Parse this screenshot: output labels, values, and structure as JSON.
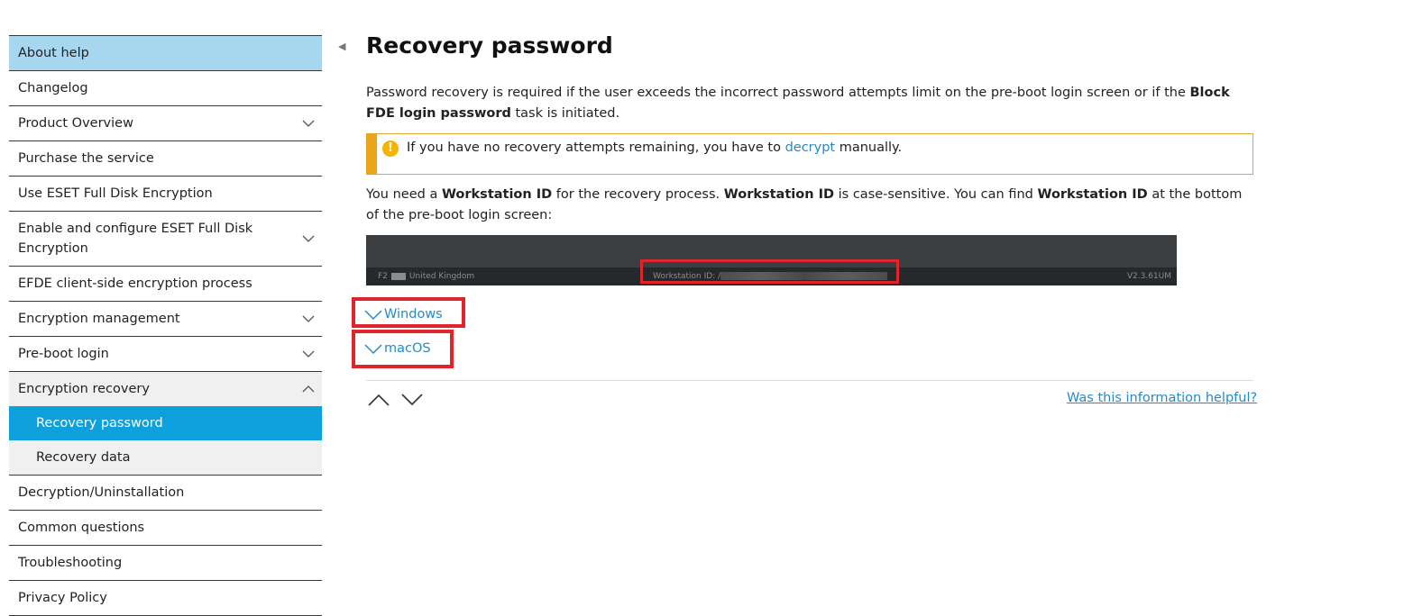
{
  "sidebar": {
    "items": [
      {
        "label": "About help"
      },
      {
        "label": "Changelog"
      },
      {
        "label": "Product Overview"
      },
      {
        "label": "Purchase the service"
      },
      {
        "label": "Use ESET Full Disk Encryption"
      },
      {
        "label": "Enable and configure ESET Full Disk Encryption"
      },
      {
        "label": "EFDE client-side encryption process"
      },
      {
        "label": "Encryption management"
      },
      {
        "label": "Pre-boot login"
      },
      {
        "label": "Encryption recovery"
      },
      {
        "label": "Recovery password"
      },
      {
        "label": "Recovery data"
      },
      {
        "label": "Decryption/Uninstallation"
      },
      {
        "label": "Common questions"
      },
      {
        "label": "Troubleshooting"
      },
      {
        "label": "Privacy Policy"
      }
    ]
  },
  "main": {
    "title": "Recovery password",
    "intro": {
      "part1": "Password recovery is required if the user exceeds the incorrect password attempts limit on the pre-boot login screen or if the ",
      "bold": "Block FDE login password",
      "part2": " task is initiated."
    },
    "callout": {
      "icon": "!",
      "before": "If you have no recovery attempts remaining, you have to ",
      "link": "decrypt",
      "after": " manually."
    },
    "workstation": {
      "t1": "You need a ",
      "b1": "Workstation ID",
      "t2": " for the recovery process. ",
      "b2": "Workstation ID",
      "t3": " is case-sensitive. You can find ",
      "b3": "Workstation ID",
      "t4": " at the bottom of the pre-boot login screen:"
    },
    "screenshot": {
      "key": "F2",
      "locale": "United Kingdom",
      "workstation_label": "Workstation ID: /",
      "version": "V2.3.61UM"
    },
    "expanders": [
      {
        "label": "Windows"
      },
      {
        "label": "macOS"
      }
    ],
    "helpful_link": "Was this information helpful?"
  },
  "colors": {
    "accent": "#0ea0dc",
    "about_bg": "#a7d6ef",
    "link": "#2789c7",
    "warning": "#eba41c",
    "highlight_box": "#e0242b"
  }
}
